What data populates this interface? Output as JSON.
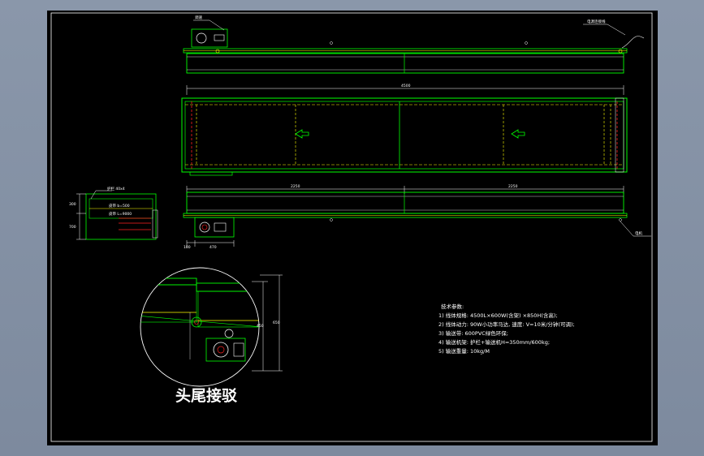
{
  "drawing": {
    "dimensions": {
      "overall_length": "4500",
      "segment_left": "2250",
      "segment_right": "2250",
      "bottom_left": "180",
      "bottom_mid": "470",
      "side_h1": "300",
      "side_h2": "700",
      "detail_h1": "450",
      "detail_h2": "650"
    },
    "callouts": {
      "top_left_tag": "调速",
      "top_right_tag": "电源连接线",
      "bottom_right_tag": "电机",
      "side_tag": "护栏 40x4",
      "side_sub1": "皮带 b=500",
      "side_sub2": "皮带 L=9000"
    },
    "detail_title": "头尾接驳",
    "tech_notes": {
      "heading": "技术参数:",
      "lines": [
        "1) 线体规格: 4500L×600W(含架) ×850H(含高);",
        "2) 线体动力: 90W小功率马达, 速度: V=10米/分钟(可调);",
        "3) 输送带: 600PVC绿色环保;",
        "4) 输送机架: 护栏+输送机H=350mm/600kg;",
        "5) 输送重量: 10kg/M"
      ]
    },
    "colors": {
      "frame": "#00ff00",
      "belt": "#ffff00",
      "red": "#ff2020",
      "white": "#ffffff",
      "cyan": "#00ffff",
      "sheet": "#000000",
      "background": "#8a97aa"
    }
  }
}
